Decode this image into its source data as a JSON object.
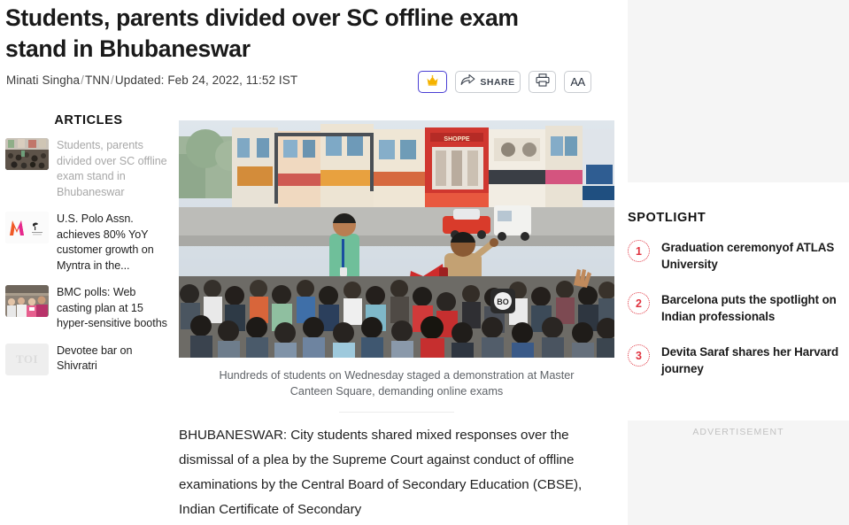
{
  "article": {
    "title": "Students, parents divided over SC offline exam stand in Bhubaneswar",
    "author": "Minati Singha",
    "source": "TNN",
    "updated": "Updated: Feb 24, 2022, 11:52 IST",
    "byline_sep": "/",
    "hero_caption": "Hundreds of students on Wednesday staged a demonstration at Master Canteen Square, demanding online exams",
    "body": "BHUBANESWAR: City students shared mixed responses over the dismissal of a plea by the Supreme Court against conduct of offline examinations by the Central Board of Secondary Education (CBSE), Indian Certificate of Secondary"
  },
  "actions": {
    "crown_icon": "crown-icon",
    "share_label": "SHARE",
    "share_icon": "share-arrow-icon",
    "print_icon": "printer-icon",
    "font_size_label": "AA"
  },
  "articles_rail": {
    "heading": "ARTICLES",
    "items": [
      {
        "title": "Students, parents divided over SC offline exam stand in Bhubaneswar",
        "thumb": "protest-crowd-thumb",
        "active": true
      },
      {
        "title": "U.S. Polo Assn. achieves 80% YoY customer growth on Myntra in the...",
        "thumb": "myntra-logo-thumb",
        "active": false
      },
      {
        "title": "BMC polls: Web casting plan at 15 hyper-sensitive booths",
        "thumb": "voters-thumb",
        "active": false
      },
      {
        "title": "Devotee bar on Shivratri",
        "thumb": "toi-placeholder-thumb",
        "placeholder_text": "TOI",
        "active": false
      }
    ]
  },
  "spotlight": {
    "heading": "SPOTLIGHT",
    "items": [
      {
        "num": "1",
        "title": "Graduation ceremonyof ATLAS University"
      },
      {
        "num": "2",
        "title": "Barcelona puts the spotlight on Indian professionals"
      },
      {
        "num": "3",
        "title": "Devita Saraf shares her Harvard journey"
      }
    ]
  },
  "ads": {
    "bottom_label": "ADVERTISEMENT"
  },
  "colors": {
    "accent_red": "#e0333f",
    "crown_border": "#4a3fd4",
    "crown_gold": "#f5b301",
    "text_dark": "#1a1a1a",
    "muted": "#a8a8a8",
    "ad_bg": "#f5f5f5"
  }
}
